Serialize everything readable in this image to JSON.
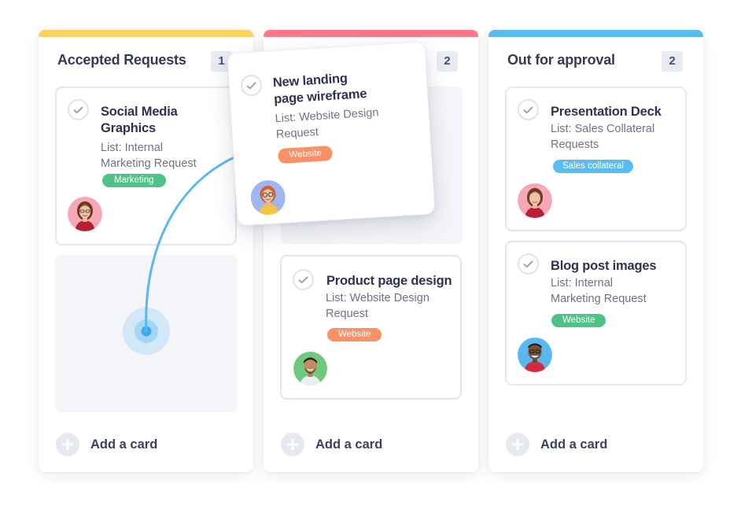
{
  "colors": {
    "accepted_bar": "#fad25d",
    "middle_bar": "#f9798b",
    "approval_bar": "#5bbcf0",
    "tag_marketing": "#4cc488",
    "tag_website_orange": "#fb8f65",
    "tag_website_green": "#4cc488",
    "tag_sales": "#5bbcf0",
    "arrow": "#5ab8f0"
  },
  "columns": [
    {
      "title": "Accepted Requests",
      "count": "1",
      "add_label": "Add a card",
      "cards": [
        {
          "title_lines": [
            "Social Media",
            "Graphics"
          ],
          "list_lines": [
            "List: Internal",
            "Marketing Request"
          ],
          "tag": "Marketing"
        }
      ]
    },
    {
      "title": "",
      "count": "2",
      "add_label": "Add a card",
      "cards": [
        {
          "title": "Product page design",
          "list_lines": [
            "List: Website Design",
            "Request"
          ],
          "tag": "Website"
        }
      ]
    },
    {
      "title": "Out for approval",
      "count": "2",
      "add_label": "Add a card",
      "cards": [
        {
          "title": "Presentation Deck",
          "list_lines": [
            "List: Sales Collateral",
            "Requests"
          ],
          "tag": "Sales collateral"
        },
        {
          "title": "Blog post images",
          "list_lines": [
            "List: Internal",
            "Marketing Request"
          ],
          "tag": "Website"
        }
      ]
    }
  ],
  "dragging_card": {
    "title_lines": [
      "New landing",
      "page wireframe"
    ],
    "list_lines": [
      "List: Website Design",
      "Request"
    ],
    "tag": "Website"
  },
  "icons": {
    "check": "check-circle-icon",
    "add": "plus-circle-icon",
    "drag_arrow": "curved-arrow-icon"
  }
}
